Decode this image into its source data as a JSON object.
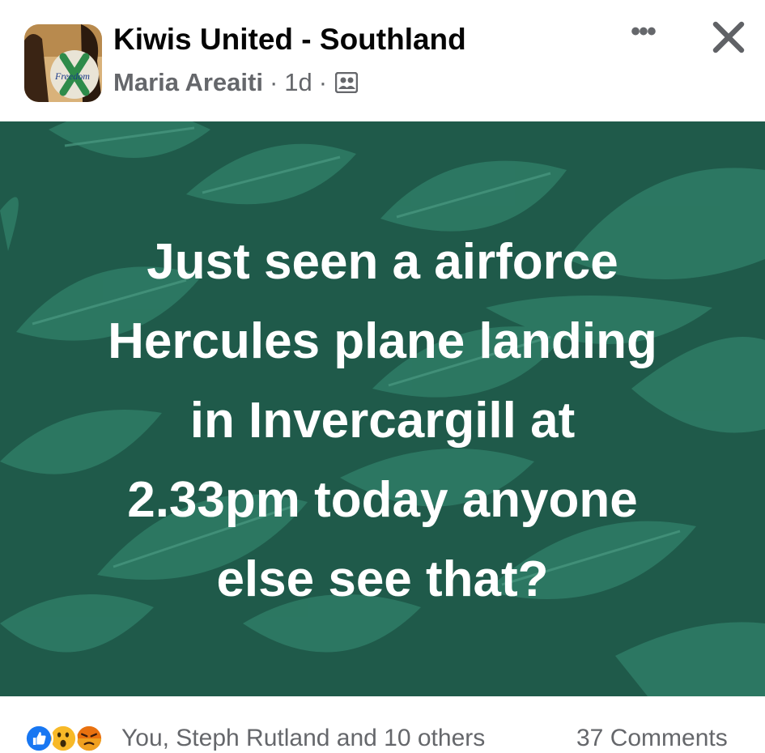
{
  "post": {
    "group_name": "Kiwis United - Southland",
    "author": "Maria Areaiti",
    "sep1": "·",
    "age": "1d",
    "sep2": "·",
    "avatar_text": "Freedom",
    "more_label": "•••",
    "text": "Just seen a airforce\nHercules plane landing\nin Invercargill at\n2.33pm today anyone\nelse see that?",
    "background_color": "#1f5a4a",
    "leaf_color": "#2f7d66"
  },
  "reactions": {
    "types": [
      "like-icon",
      "wow-icon",
      "angry-icon"
    ],
    "summary": "You, Steph Rutland and 10 others",
    "comments": "37 Comments"
  }
}
